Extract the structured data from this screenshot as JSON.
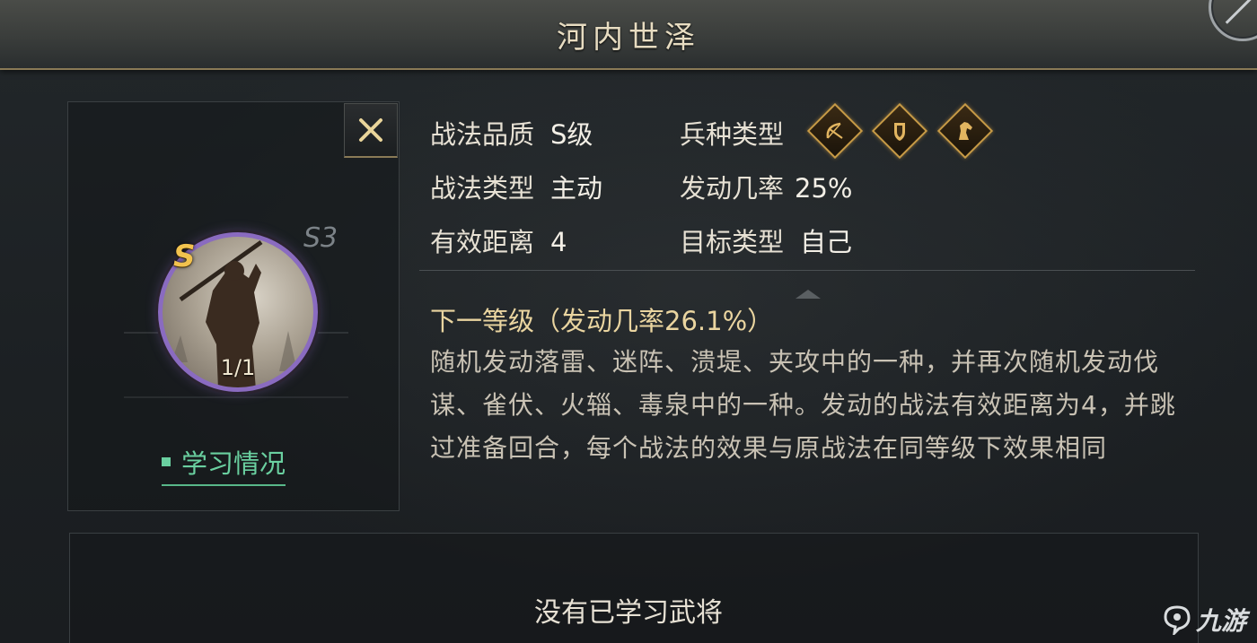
{
  "header": {
    "title": "河内世泽"
  },
  "skill": {
    "close_icon": "close-icon",
    "rank_label": "S3",
    "quality_badge": "S",
    "learned_count": "1/1",
    "learn_status_link": "学习情况",
    "accent_purple": "#8a6bc0",
    "accent_gold": "#f2c24e",
    "link_green": "#6ad0a0"
  },
  "info": {
    "quality_label": "战法品质",
    "quality_value": "S级",
    "troop_label": "兵种类型",
    "troop_icons": [
      "bow-icon",
      "shield-icon",
      "horse-icon"
    ],
    "type_label": "战法类型",
    "type_value": "主动",
    "rate_label": "发动几率",
    "rate_value": "25%",
    "range_label": "有效距离",
    "range_value": "4",
    "target_label": "目标类型",
    "target_value": "自己"
  },
  "next_level": "下一等级（发动几率26.1%）",
  "description": "随机发动落雷、迷阵、溃堤、夹攻中的一种，并再次随机发动伐谋、雀伏、火辎、毒泉中的一种。发动的战法有效距离为4，并跳过准备回合，每个战法的效果与原战法在同等级下效果相同",
  "learned_generals": {
    "empty_text": "没有已学习武将"
  },
  "watermark": {
    "text": "九游"
  }
}
